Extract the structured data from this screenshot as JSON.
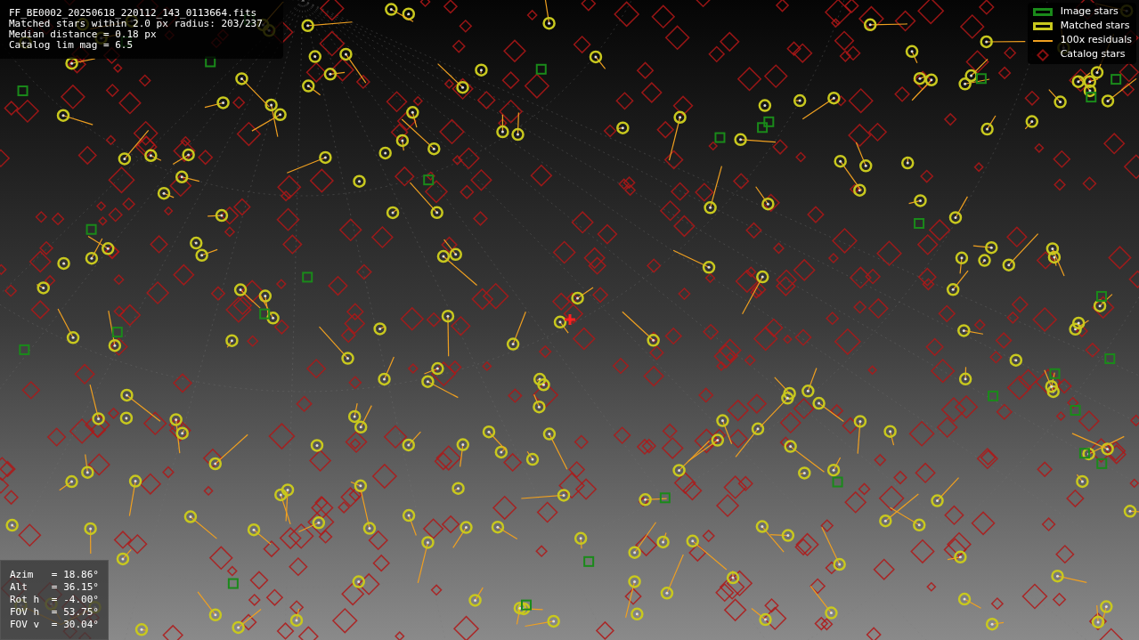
{
  "info_panel": {
    "lines": [
      "FF_BE0002_20250618_220112_143_0113664.fits",
      "Matched stars within 2.0 px radius: 203/237",
      "Median distance = 0.18 px",
      "Catalog lim mag = 6.5"
    ]
  },
  "legend": [
    {
      "kind": "box",
      "label": "Image stars",
      "color": "#1a8a1a"
    },
    {
      "kind": "box",
      "label": "Matched stars",
      "color": "#c8c81e"
    },
    {
      "kind": "line",
      "label": "100x residuals",
      "color": "#f0a020"
    },
    {
      "kind": "diamond",
      "label": "Catalog stars",
      "color": "#8a1010"
    }
  ],
  "pointing_panel": {
    "rows": [
      {
        "label": "Azim",
        "sep": "=",
        "value": "18.86°"
      },
      {
        "label": "Alt",
        "sep": "=",
        "value": "36.15°"
      },
      {
        "label": "Rot h",
        "sep": "=",
        "value": "-4.00°"
      },
      {
        "label": "FOV h",
        "sep": "=",
        "value": "53.75°"
      },
      {
        "label": "FOV v",
        "sep": "=",
        "value": "30.04°"
      }
    ]
  }
}
